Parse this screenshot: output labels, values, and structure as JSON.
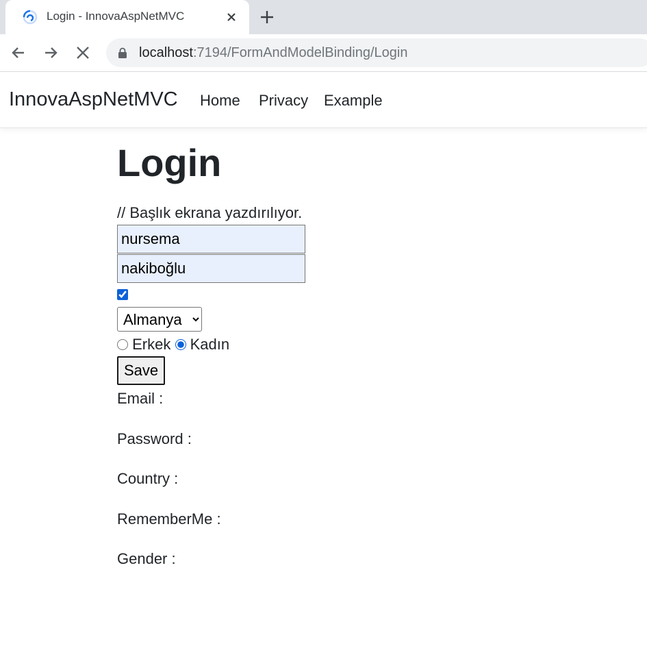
{
  "browser": {
    "tab_title": "Login - InnovaAspNetMVC",
    "url_host": "localhost",
    "url_rest": ":7194/FormAndModelBinding/Login"
  },
  "navbar": {
    "brand": "InnovaAspNetMVC",
    "links": [
      "Home",
      "Privacy",
      "Example"
    ]
  },
  "page": {
    "title": "Login",
    "comment": "// Başlık ekrana yazdırılıyor.",
    "email_value": "nursema",
    "password_value": "nakiboğlu",
    "remember_checked": true,
    "country_selected": "Almanya",
    "gender_options": [
      "Erkek",
      "Kadın"
    ],
    "gender_selected": "Kadın",
    "save_label": "Save",
    "results": [
      "Email :",
      "Password :",
      "Country :",
      "RememberMe :",
      "Gender :"
    ]
  },
  "colors": {
    "accent": "#0b61d9",
    "input_autofill_bg": "#e8f0fe",
    "tabstrip_bg": "#dee1e6"
  }
}
